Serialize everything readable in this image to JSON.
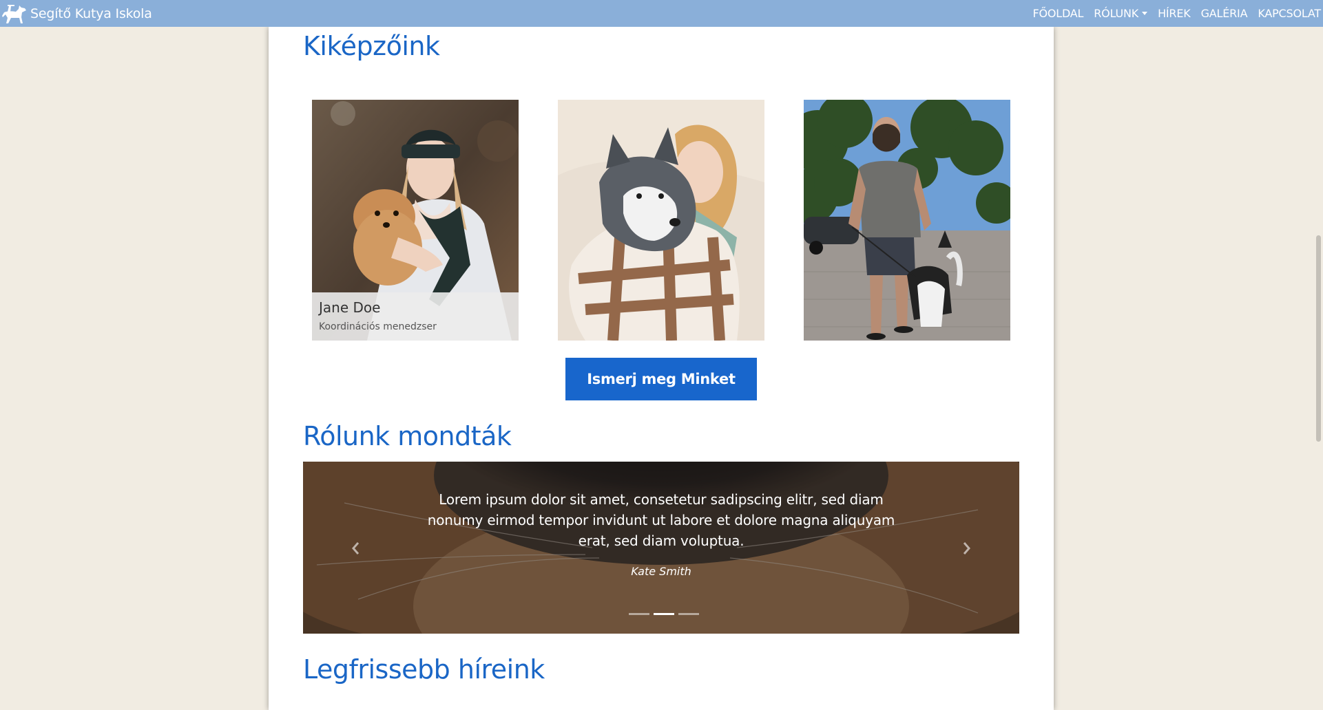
{
  "navbar": {
    "brand": "Segítő Kutya Iskola",
    "links": [
      "FŐOLDAL",
      "RÓLUNK",
      "HÍREK",
      "GALÉRIA",
      "KAPCSOLAT"
    ],
    "bg_color": "#8aafd9"
  },
  "trainers": {
    "heading": "Kiképzőink",
    "cards": [
      {
        "name": "Jane Doe",
        "role": "Koordinációs menedzser"
      }
    ],
    "button": "Ismerj meg Minket"
  },
  "testimonials": {
    "heading": "Rólunk mondták",
    "quote": "Lorem ipsum dolor sit amet, consetetur sadipscing elitr, sed diam nonumy eirmod tempor invidunt ut labore et dolore magna aliquyam erat, sed diam voluptua.",
    "author": "Kate Smith",
    "slide_count": 3,
    "active_slide": 2
  },
  "news": {
    "heading": "Legfrissebb híreink"
  },
  "colors": {
    "accent": "#1a66c6",
    "button": "#1866cc",
    "page_bg": "#f1ece2"
  }
}
